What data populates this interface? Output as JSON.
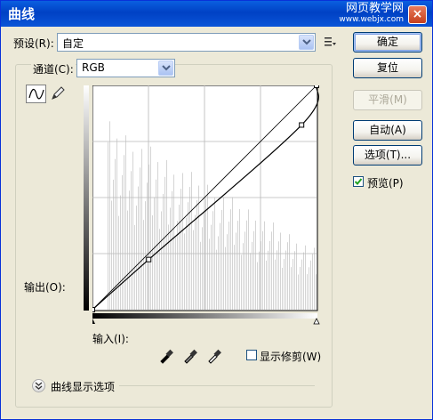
{
  "window": {
    "title": "曲线",
    "watermark_line1": "网页教学网",
    "watermark_line2": "www.webjx.com"
  },
  "preset": {
    "label": "预设(R):",
    "value": "自定"
  },
  "channel": {
    "label": "通道(C):",
    "value": "RGB"
  },
  "buttons": {
    "ok": "确定",
    "reset": "复位",
    "smooth": "平滑(M)",
    "auto": "自动(A)",
    "options": "选项(T)...",
    "preview_label": "预览(P)"
  },
  "preview_checked": true,
  "labels": {
    "output": "输出(O):",
    "input": "输入(I):",
    "show_clipping": "显示修剪(W)",
    "curve_display_options": "曲线显示选项"
  },
  "show_clipping_checked": false,
  "curve": {
    "points": [
      [
        0,
        0
      ],
      [
        64,
        57
      ],
      [
        238,
        210
      ],
      [
        255,
        255
      ]
    ]
  },
  "icons": {
    "curve_tool": "curve-tool-icon",
    "pencil_tool": "pencil-icon",
    "menu": "preset-menu-icon",
    "eyedroppers": [
      "black-eyedropper-icon",
      "gray-eyedropper-icon",
      "white-eyedropper-icon"
    ]
  },
  "colors": {
    "title_bar": "#0a55d8",
    "accent": "#316ac5",
    "histogram": "#d4d4d4"
  }
}
